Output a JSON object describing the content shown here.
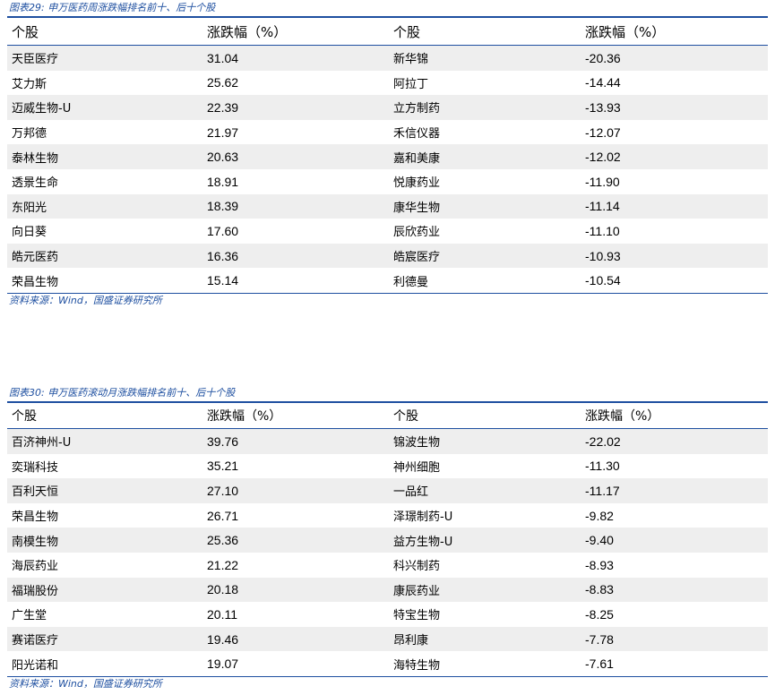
{
  "tables": [
    {
      "title": "图表29: 申万医药周涨跌幅排名前十、后十个股",
      "headers": [
        "个股",
        "涨跌幅（%）",
        "个股",
        "涨跌幅（%）"
      ],
      "rows": [
        {
          "top_name": "天臣医疗",
          "top_change": "31.04",
          "bottom_name": "新华锦",
          "bottom_change": "-20.36"
        },
        {
          "top_name": "艾力斯",
          "top_change": "25.62",
          "bottom_name": "阿拉丁",
          "bottom_change": "-14.44"
        },
        {
          "top_name": "迈威生物-U",
          "top_change": "22.39",
          "bottom_name": "立方制药",
          "bottom_change": "-13.93"
        },
        {
          "top_name": "万邦德",
          "top_change": "21.97",
          "bottom_name": "禾信仪器",
          "bottom_change": "-12.07"
        },
        {
          "top_name": "泰林生物",
          "top_change": "20.63",
          "bottom_name": "嘉和美康",
          "bottom_change": "-12.02"
        },
        {
          "top_name": "透景生命",
          "top_change": "18.91",
          "bottom_name": "悦康药业",
          "bottom_change": "-11.90"
        },
        {
          "top_name": "东阳光",
          "top_change": "18.39",
          "bottom_name": "康华生物",
          "bottom_change": "-11.14"
        },
        {
          "top_name": "向日葵",
          "top_change": "17.60",
          "bottom_name": "辰欣药业",
          "bottom_change": "-11.10"
        },
        {
          "top_name": "皓元医药",
          "top_change": "16.36",
          "bottom_name": "皓宸医疗",
          "bottom_change": "-10.93"
        },
        {
          "top_name": "荣昌生物",
          "top_change": "15.14",
          "bottom_name": "利德曼",
          "bottom_change": "-10.54"
        }
      ],
      "source": "资料来源：Wind，国盛证券研究所"
    },
    {
      "title": "图表30: 申万医药滚动月涨跌幅排名前十、后十个股",
      "headers": [
        "个股",
        "涨跌幅（%）",
        "个股",
        "涨跌幅（%）"
      ],
      "rows": [
        {
          "top_name": "百济神州-U",
          "top_change": "39.76",
          "bottom_name": "锦波生物",
          "bottom_change": "-22.02"
        },
        {
          "top_name": "奕瑞科技",
          "top_change": "35.21",
          "bottom_name": "神州细胞",
          "bottom_change": "-11.30"
        },
        {
          "top_name": "百利天恒",
          "top_change": "27.10",
          "bottom_name": "一品红",
          "bottom_change": "-11.17"
        },
        {
          "top_name": "荣昌生物",
          "top_change": "26.71",
          "bottom_name": "泽璟制药-U",
          "bottom_change": "-9.82"
        },
        {
          "top_name": "南模生物",
          "top_change": "25.36",
          "bottom_name": "益方生物-U",
          "bottom_change": "-9.40"
        },
        {
          "top_name": "海辰药业",
          "top_change": "21.22",
          "bottom_name": "科兴制药",
          "bottom_change": "-8.93"
        },
        {
          "top_name": "福瑞股份",
          "top_change": "20.18",
          "bottom_name": "康辰药业",
          "bottom_change": "-8.83"
        },
        {
          "top_name": "广生堂",
          "top_change": "20.11",
          "bottom_name": "特宝生物",
          "bottom_change": "-8.25"
        },
        {
          "top_name": "赛诺医疗",
          "top_change": "19.46",
          "bottom_name": "昂利康",
          "bottom_change": "-7.78"
        },
        {
          "top_name": "阳光诺和",
          "top_change": "19.07",
          "bottom_name": "海特生物",
          "bottom_change": "-7.61"
        }
      ],
      "source": "资料来源：Wind，国盛证券研究所"
    }
  ]
}
